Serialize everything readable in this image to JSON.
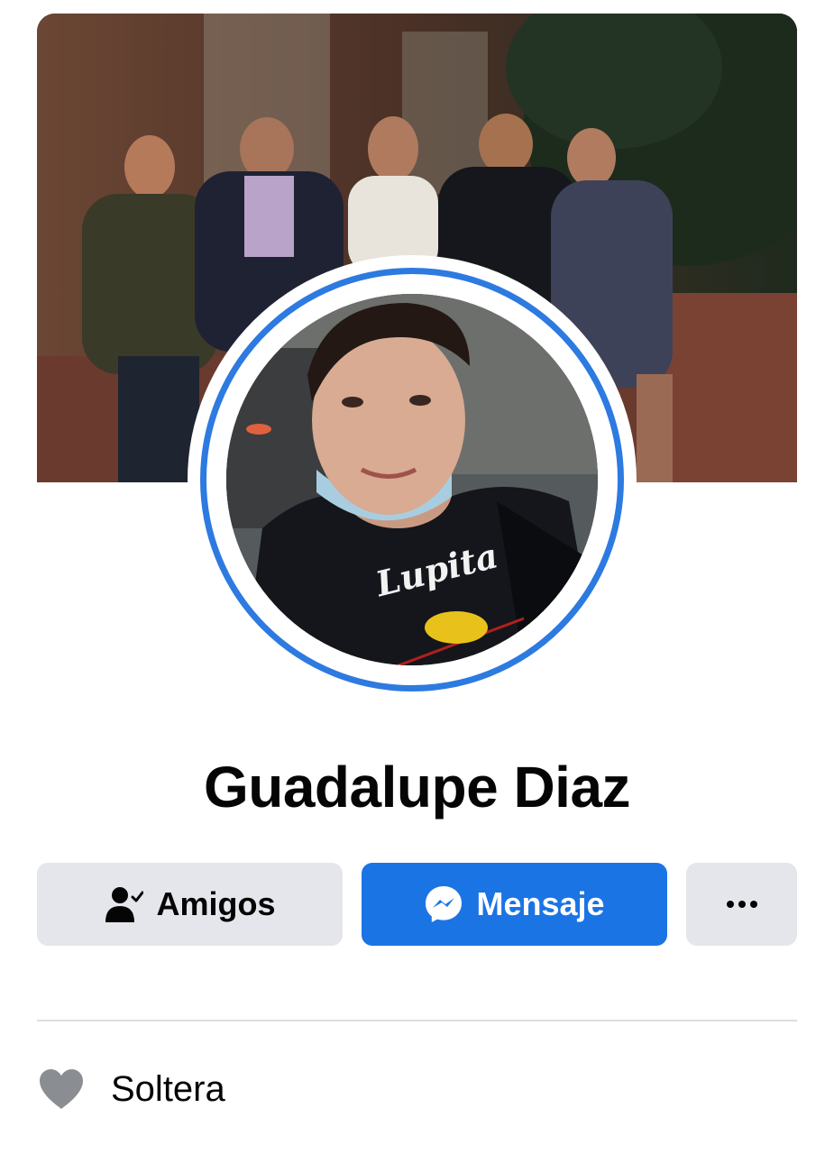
{
  "profile": {
    "name": "Guadalupe Diaz",
    "cover_photo": "group-photo-five-people-night",
    "avatar_photo": "selfie-woman-black-shirt"
  },
  "actions": {
    "friends_label": "Amigos",
    "friends_icon": "friends-check-icon",
    "message_label": "Mensaje",
    "message_icon": "messenger-icon",
    "more_icon": "more-dots-icon"
  },
  "about": {
    "relationship": "Soltera",
    "relationship_icon": "heart-icon"
  },
  "colors": {
    "accent": "#1b74e4",
    "ring": "#2d7ae0",
    "button_secondary": "#e4e6eb",
    "icon_gray": "#8a8d91"
  }
}
